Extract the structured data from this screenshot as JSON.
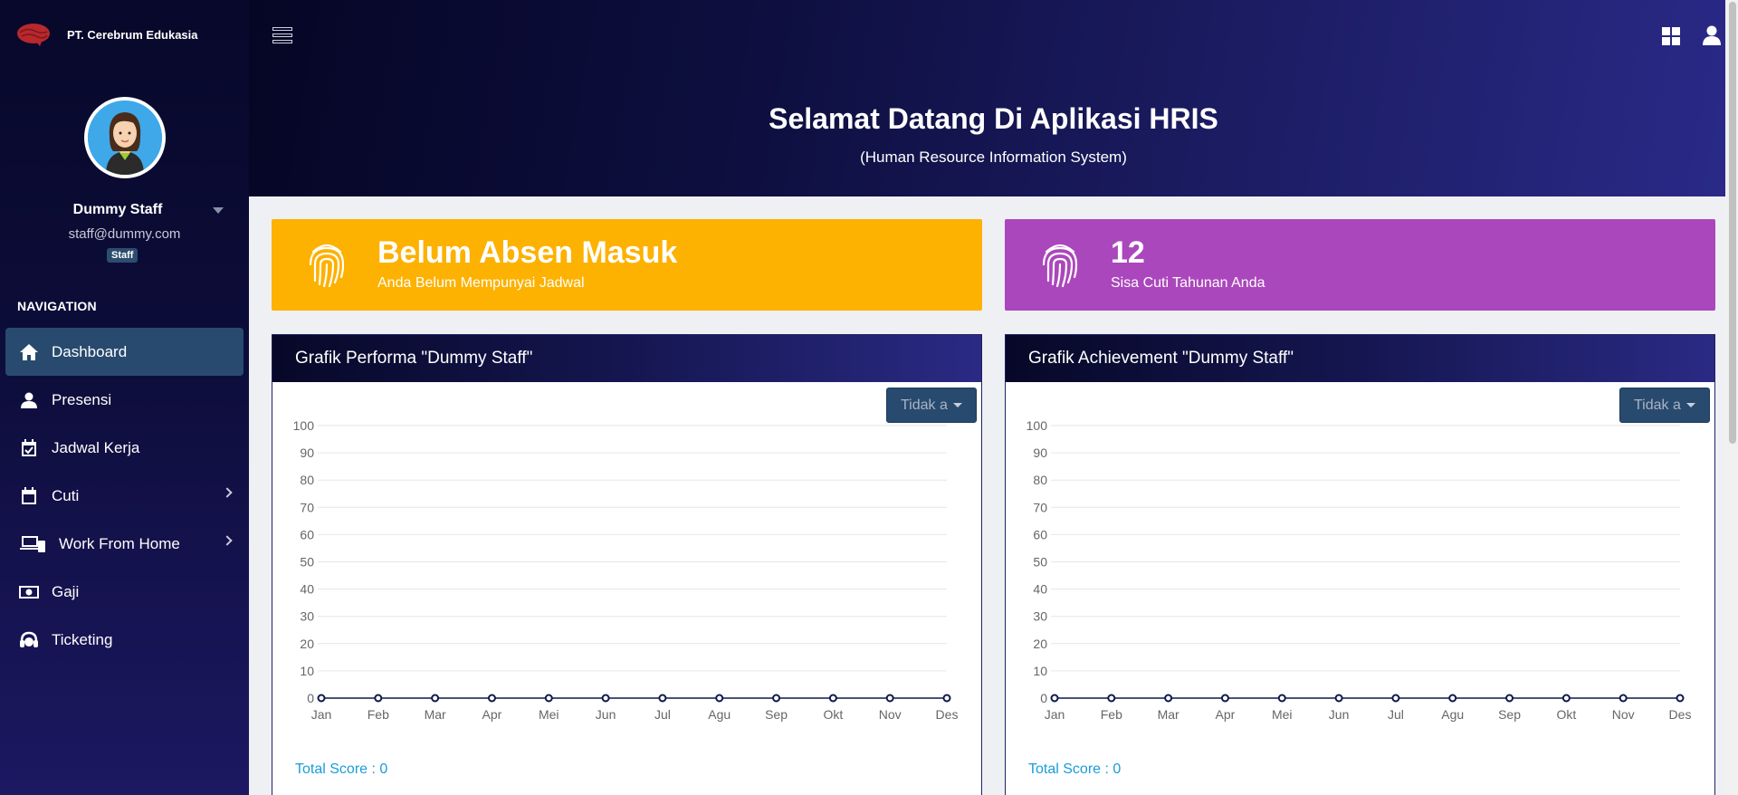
{
  "brand": {
    "name": "PT. Cerebrum Edukasia"
  },
  "user": {
    "name": "Dummy Staff",
    "email": "staff@dummy.com",
    "role": "Staff"
  },
  "nav": {
    "heading": "NAVIGATION",
    "items": [
      {
        "label": "Dashboard",
        "icon": "home-icon",
        "active": true
      },
      {
        "label": "Presensi",
        "icon": "user-icon"
      },
      {
        "label": "Jadwal Kerja",
        "icon": "calendar-check-icon"
      },
      {
        "label": "Cuti",
        "icon": "calendar-icon",
        "has_submenu": true
      },
      {
        "label": "Work From Home",
        "icon": "laptop-icon",
        "has_submenu": true
      },
      {
        "label": "Gaji",
        "icon": "money-icon"
      },
      {
        "label": "Ticketing",
        "icon": "headset-icon"
      }
    ]
  },
  "header": {
    "title": "Selamat Datang Di Aplikasi HRIS",
    "subtitle": "(Human Resource Information System)"
  },
  "cards": {
    "attendance": {
      "main": "Belum Absen Masuk",
      "sub": "Anda Belum Mempunyai Jadwal",
      "color": "#fdb100"
    },
    "leave": {
      "main": "12",
      "sub": "Sisa Cuti Tahunan Anda",
      "color": "#ab47bc"
    }
  },
  "panels": {
    "performance": {
      "title": "Grafik Performa \"Dummy Staff\"",
      "dropdown": "Tidak a",
      "total": "Total Score : 0"
    },
    "achievement": {
      "title": "Grafik Achievement \"Dummy Staff\"",
      "dropdown": "Tidak a",
      "total": "Total Score : 0"
    }
  },
  "chart_data": [
    {
      "type": "line",
      "categories": [
        "Jan",
        "Feb",
        "Mar",
        "Apr",
        "Mei",
        "Jun",
        "Jul",
        "Agu",
        "Sep",
        "Okt",
        "Nov",
        "Des"
      ],
      "values": [
        0,
        0,
        0,
        0,
        0,
        0,
        0,
        0,
        0,
        0,
        0,
        0
      ],
      "yticks": [
        0,
        10,
        20,
        30,
        40,
        50,
        60,
        70,
        80,
        90,
        100
      ],
      "ylim": [
        0,
        100
      ],
      "grid": true
    },
    {
      "type": "line",
      "categories": [
        "Jan",
        "Feb",
        "Mar",
        "Apr",
        "Mei",
        "Jun",
        "Jul",
        "Agu",
        "Sep",
        "Okt",
        "Nov",
        "Des"
      ],
      "values": [
        0,
        0,
        0,
        0,
        0,
        0,
        0,
        0,
        0,
        0,
        0,
        0
      ],
      "yticks": [
        0,
        10,
        20,
        30,
        40,
        50,
        60,
        70,
        80,
        90,
        100
      ],
      "ylim": [
        0,
        100
      ],
      "grid": true
    }
  ]
}
